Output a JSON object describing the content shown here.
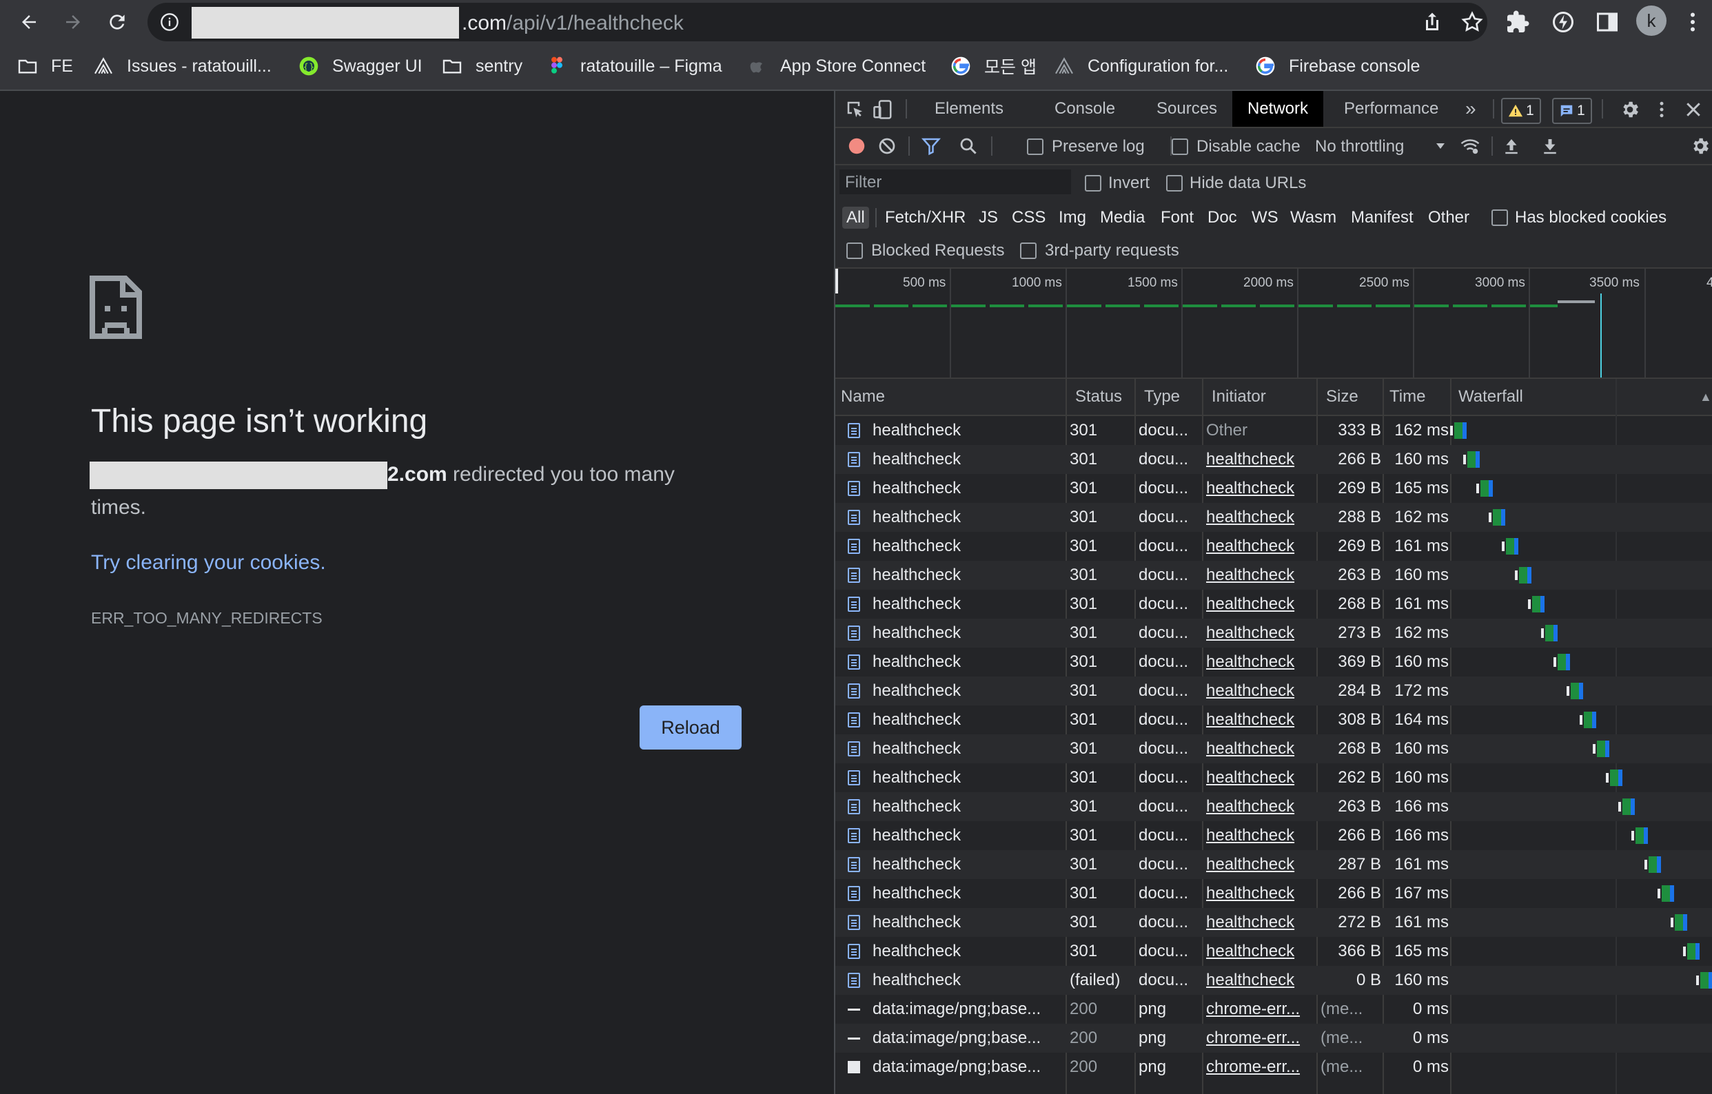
{
  "browser": {
    "url_host": ".com",
    "url_path": "/api/v1/healthcheck",
    "avatar_letter": "k",
    "bookmarks": [
      {
        "label": "FE",
        "icon": "folder-icon"
      },
      {
        "label": "Issues - ratatouill...",
        "icon": "jira-icon"
      },
      {
        "label": "Swagger UI",
        "icon": "swagger-icon"
      },
      {
        "label": "sentry",
        "icon": "folder-icon"
      },
      {
        "label": "ratatouille – Figma",
        "icon": "figma-icon"
      },
      {
        "label": "App Store Connect",
        "icon": "apple-icon"
      },
      {
        "label": "모든 앱",
        "icon": "google-icon"
      },
      {
        "label": "Configuration for...",
        "icon": "jira-icon"
      },
      {
        "label": "Firebase console",
        "icon": "google-icon"
      }
    ]
  },
  "error_page": {
    "title": "This page isn’t working",
    "host_suffix": "2.com",
    "message": " redirected you too many",
    "message_cont": "times.",
    "link": "Try clearing your cookies",
    "link_period": ".",
    "code": "ERR_TOO_MANY_REDIRECTS",
    "reload": "Reload"
  },
  "devtools": {
    "tabs": [
      "Elements",
      "Console",
      "Sources",
      "Network",
      "Performance"
    ],
    "active_tab": "Network",
    "more": "»",
    "warn_count": "1",
    "msg_count": "1",
    "toolbar": {
      "preserve_log": "Preserve log",
      "disable_cache": "Disable cache",
      "throttling": "No throttling"
    },
    "filter": {
      "placeholder": "Filter",
      "invert": "Invert",
      "hide_data_urls": "Hide data URLs",
      "types": [
        "All",
        "Fetch/XHR",
        "JS",
        "CSS",
        "Img",
        "Media",
        "Font",
        "Doc",
        "WS",
        "Wasm",
        "Manifest",
        "Other"
      ],
      "has_blocked_cookies": "Has blocked cookies",
      "blocked_requests": "Blocked Requests",
      "third_party": "3rd-party requests"
    },
    "overview_ticks": [
      "500 ms",
      "1000 ms",
      "1500 ms",
      "2000 ms",
      "2500 ms",
      "3000 ms",
      "3500 ms",
      "4"
    ],
    "columns": [
      "Name",
      "Status",
      "Type",
      "Initiator",
      "Size",
      "Time",
      "Waterfall"
    ],
    "sort_indicator": "▲",
    "requests": [
      {
        "name": "healthcheck",
        "status": "301",
        "type": "docu...",
        "initiator": "Other",
        "size": "333 B",
        "time": "162 ms",
        "icon": "document-icon"
      },
      {
        "name": "healthcheck",
        "status": "301",
        "type": "docu...",
        "initiator": "healthcheck",
        "size": "266 B",
        "time": "160 ms",
        "icon": "document-icon"
      },
      {
        "name": "healthcheck",
        "status": "301",
        "type": "docu...",
        "initiator": "healthcheck",
        "size": "269 B",
        "time": "165 ms",
        "icon": "document-icon"
      },
      {
        "name": "healthcheck",
        "status": "301",
        "type": "docu...",
        "initiator": "healthcheck",
        "size": "288 B",
        "time": "162 ms",
        "icon": "document-icon"
      },
      {
        "name": "healthcheck",
        "status": "301",
        "type": "docu...",
        "initiator": "healthcheck",
        "size": "269 B",
        "time": "161 ms",
        "icon": "document-icon"
      },
      {
        "name": "healthcheck",
        "status": "301",
        "type": "docu...",
        "initiator": "healthcheck",
        "size": "263 B",
        "time": "160 ms",
        "icon": "document-icon"
      },
      {
        "name": "healthcheck",
        "status": "301",
        "type": "docu...",
        "initiator": "healthcheck",
        "size": "268 B",
        "time": "161 ms",
        "icon": "document-icon"
      },
      {
        "name": "healthcheck",
        "status": "301",
        "type": "docu...",
        "initiator": "healthcheck",
        "size": "273 B",
        "time": "162 ms",
        "icon": "document-icon"
      },
      {
        "name": "healthcheck",
        "status": "301",
        "type": "docu...",
        "initiator": "healthcheck",
        "size": "369 B",
        "time": "160 ms",
        "icon": "document-icon"
      },
      {
        "name": "healthcheck",
        "status": "301",
        "type": "docu...",
        "initiator": "healthcheck",
        "size": "284 B",
        "time": "172 ms",
        "icon": "document-icon"
      },
      {
        "name": "healthcheck",
        "status": "301",
        "type": "docu...",
        "initiator": "healthcheck",
        "size": "308 B",
        "time": "164 ms",
        "icon": "document-icon"
      },
      {
        "name": "healthcheck",
        "status": "301",
        "type": "docu...",
        "initiator": "healthcheck",
        "size": "268 B",
        "time": "160 ms",
        "icon": "document-icon"
      },
      {
        "name": "healthcheck",
        "status": "301",
        "type": "docu...",
        "initiator": "healthcheck",
        "size": "262 B",
        "time": "160 ms",
        "icon": "document-icon"
      },
      {
        "name": "healthcheck",
        "status": "301",
        "type": "docu...",
        "initiator": "healthcheck",
        "size": "263 B",
        "time": "166 ms",
        "icon": "document-icon"
      },
      {
        "name": "healthcheck",
        "status": "301",
        "type": "docu...",
        "initiator": "healthcheck",
        "size": "266 B",
        "time": "166 ms",
        "icon": "document-icon"
      },
      {
        "name": "healthcheck",
        "status": "301",
        "type": "docu...",
        "initiator": "healthcheck",
        "size": "287 B",
        "time": "161 ms",
        "icon": "document-icon"
      },
      {
        "name": "healthcheck",
        "status": "301",
        "type": "docu...",
        "initiator": "healthcheck",
        "size": "266 B",
        "time": "167 ms",
        "icon": "document-icon"
      },
      {
        "name": "healthcheck",
        "status": "301",
        "type": "docu...",
        "initiator": "healthcheck",
        "size": "272 B",
        "time": "161 ms",
        "icon": "document-icon"
      },
      {
        "name": "healthcheck",
        "status": "301",
        "type": "docu...",
        "initiator": "healthcheck",
        "size": "366 B",
        "time": "165 ms",
        "icon": "document-icon"
      },
      {
        "name": "healthcheck",
        "status": "(failed)",
        "type": "docu...",
        "initiator": "healthcheck",
        "size": "0 B",
        "time": "160 ms",
        "icon": "document-icon"
      },
      {
        "name": "data:image/png;base...",
        "status": "200",
        "type": "png",
        "initiator": "chrome-err...",
        "size": "(me...",
        "time": "0 ms",
        "icon": "image-icon"
      },
      {
        "name": "data:image/png;base...",
        "status": "200",
        "type": "png",
        "initiator": "chrome-err...",
        "size": "(me...",
        "time": "0 ms",
        "icon": "image-icon"
      },
      {
        "name": "data:image/png;base...",
        "status": "200",
        "type": "png",
        "initiator": "chrome-err...",
        "size": "(me...",
        "time": "0 ms",
        "icon": "image-icon"
      }
    ]
  }
}
